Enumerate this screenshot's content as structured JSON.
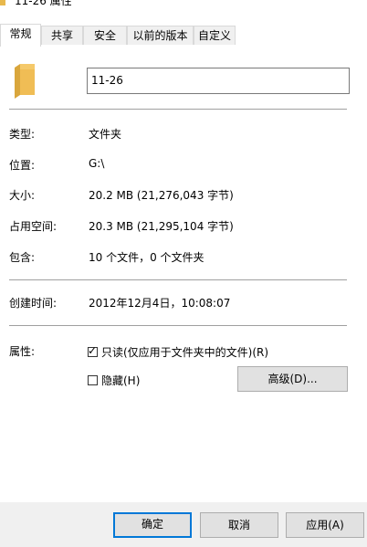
{
  "window": {
    "title": "11-26 属性"
  },
  "tabs": [
    {
      "label": "常规"
    },
    {
      "label": "共享"
    },
    {
      "label": "安全"
    },
    {
      "label": "以前的版本"
    },
    {
      "label": "自定义"
    }
  ],
  "folder": {
    "name": "11-26"
  },
  "props": {
    "type_label": "类型:",
    "type_value": "文件夹",
    "location_label": "位置:",
    "location_value": "G:\\",
    "size_label": "大小:",
    "size_value": "20.2 MB (21,276,043 字节)",
    "disk_label": "占用空间:",
    "disk_value": "20.3 MB (21,295,104 字节)",
    "contains_label": "包含:",
    "contains_value": "10 个文件，0 个文件夹",
    "created_label": "创建时间:",
    "created_value": "2012年12月4日，10:08:07",
    "attributes_label": "属性:"
  },
  "attributes": {
    "readonly_label": "只读(仅应用于文件夹中的文件)(R)",
    "readonly_checked": true,
    "hidden_label": "隐藏(H)",
    "hidden_checked": false,
    "advanced_label": "高级(D)..."
  },
  "buttons": {
    "ok": "确定",
    "cancel": "取消",
    "apply": "应用(A)"
  },
  "icons": {
    "folder": "folder-icon",
    "check": "check-icon"
  },
  "colors": {
    "folder": "#e8b84c",
    "accent": "#0078d7",
    "footer": "#f0f0f0"
  }
}
